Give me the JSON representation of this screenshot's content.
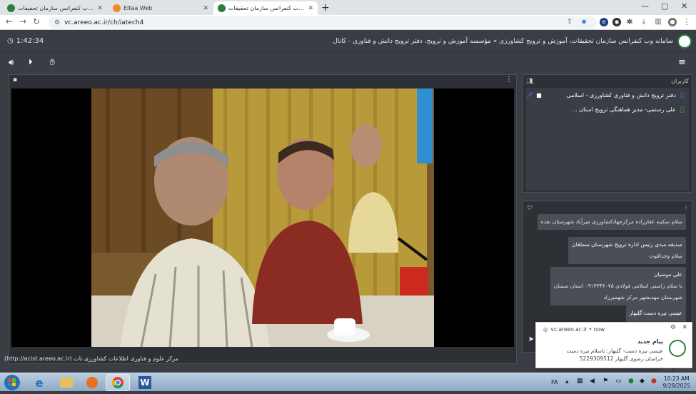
{
  "browser": {
    "tabs": [
      {
        "title": "سامانه وب کنفرانس سازمان تحقیقات",
        "active": false
      },
      {
        "title": "Eitaa Web",
        "active": false
      },
      {
        "title": "سامانه وب کنفرانس سازمان تحقیقات",
        "active": true
      }
    ],
    "url": "vc.areeo.ac.ir/ch/iatech4"
  },
  "app": {
    "timer": "1:42:34",
    "title": "سامانه وب کنفرانس سازمان تحقیقات، آموزش و ترویج کشاورزی » مؤسسه آموزش و ترویج، دفتر ترویج دانش و فناوری - کانال"
  },
  "video": {
    "credit": "مرکز علوم و فناوری اطلاعات کشاورزی تات (http://acist.areeo.ac.ir)"
  },
  "users": {
    "header": "کاربران",
    "list": [
      {
        "name": "دفتر ترویج دانش و فناوری کشاورزی - اسلامی",
        "color": "#3d8bfd",
        "mic": true,
        "cam": true
      },
      {
        "name": "علی رستمی- مدیر هماهنگی ترویج استان ...",
        "color": "#3ec46d",
        "mic": false,
        "cam": false
      }
    ]
  },
  "chat": {
    "messages": [
      {
        "who": "",
        "text": "سلام سکینه غفارزاده مرکزجهادکشاورزی میرآباد شهرستان نقده"
      },
      {
        "who": "صدیقه مبدی رئیس اداره ترویج شهرستان سملقان",
        "text": "سلام وخداقوت"
      },
      {
        "who": "علی مومنیان",
        "text": "با سلام راستی اسلامی فولادی ۰۹۱۳۳۴۶۰۷۵ استان سمنان",
        "text2": "شهرستان مهدیشهر مرکز شهمیرزاد"
      },
      {
        "who": "عیسی تیره دست-گلبهار",
        "text": "5229309512"
      }
    ]
  },
  "toast": {
    "source": "vc.areeo.ac.ir • now",
    "title": "پیام جدید",
    "body": "عیسی تیره دست- گلبهار: باسلام تیره دست خراسان رضوی گلبهار 5229309512"
  },
  "taskbar": {
    "lang": "FA",
    "time": "10:23 AM",
    "date": "9/28/2025",
    "show_desktop": "Show desktop"
  }
}
